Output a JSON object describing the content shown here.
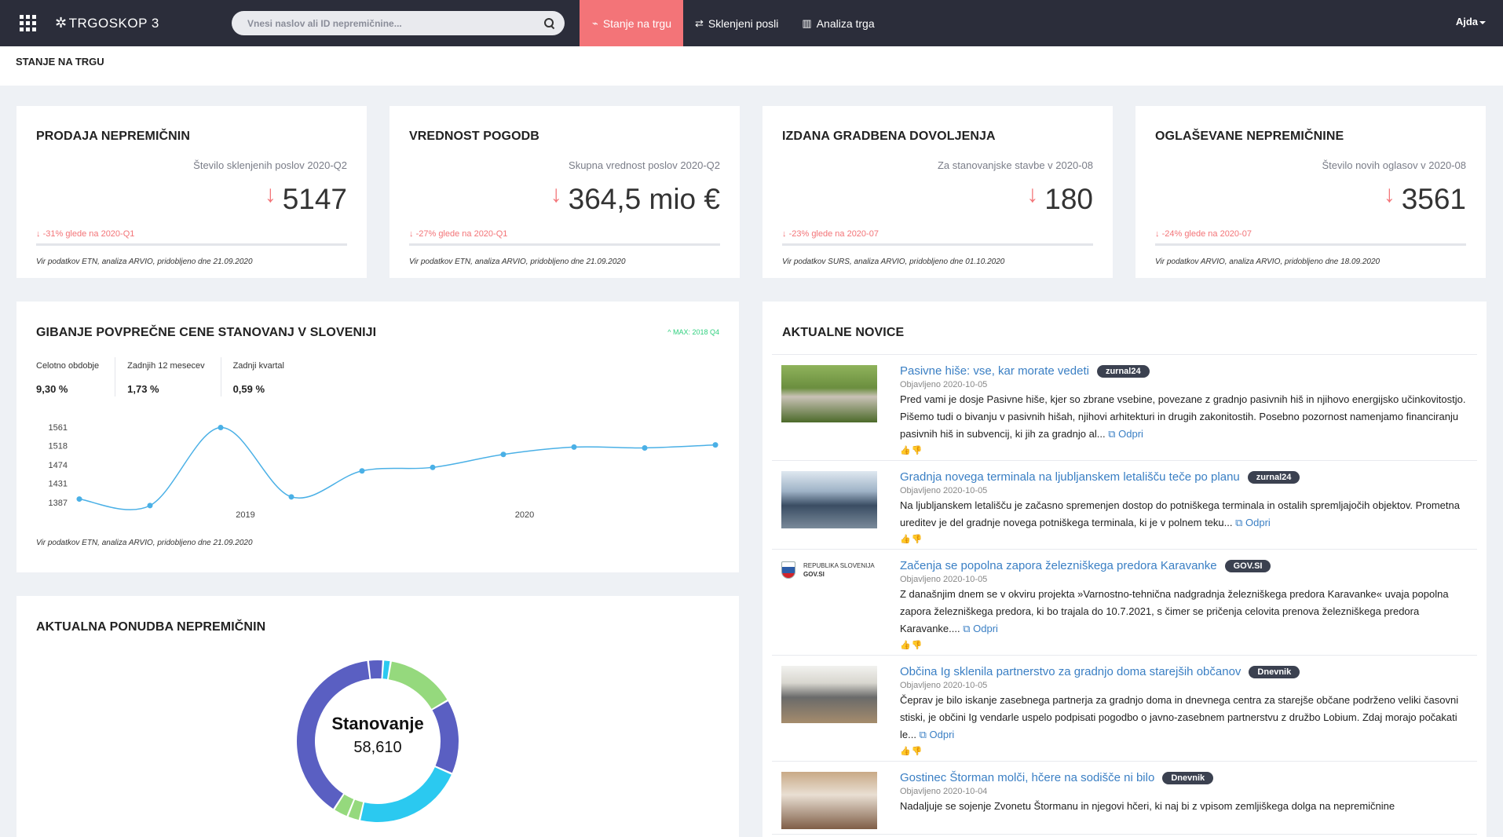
{
  "navbar": {
    "brand": "TRGOSKOP 3",
    "search_placeholder": "Vnesi naslov ali ID nepremičnine...",
    "items": [
      {
        "label": "Stanje na trgu",
        "active": true
      },
      {
        "label": "Sklenjeni posli",
        "active": false
      },
      {
        "label": "Analiza trga",
        "active": false
      }
    ],
    "user": "Ajda"
  },
  "breadcrumb": "STANJE NA TRGU",
  "kpis": [
    {
      "title": "PRODAJA NEPREMIČNIN",
      "subtitle": "Število sklenjenih poslov 2020-Q2",
      "value": "5147",
      "delta": "-31%",
      "delta_text": "glede na 2020-Q1",
      "source": "Vir podatkov ETN, analiza ARVIO, pridobljeno dne 21.09.2020"
    },
    {
      "title": "VREDNOST POGODB",
      "subtitle": "Skupna vrednost poslov 2020-Q2",
      "value": "364,5 mio €",
      "delta": "-27%",
      "delta_text": "glede na 2020-Q1",
      "source": "Vir podatkov ETN, analiza ARVIO, pridobljeno dne 21.09.2020"
    },
    {
      "title": "IZDANA GRADBENA DOVOLJENJA",
      "subtitle": "Za stanovanjske stavbe v 2020-08",
      "value": "180",
      "delta": "-23%",
      "delta_text": "glede na 2020-07",
      "source": "Vir podatkov SURS, analiza ARVIO, pridobljeno dne 01.10.2020"
    },
    {
      "title": "OGLAŠEVANE NEPREMIČNINE",
      "subtitle": "Število novih oglasov v 2020-08",
      "value": "3561",
      "delta": "-24%",
      "delta_text": "glede na 2020-07",
      "source": "Vir podatkov ARVIO, analiza ARVIO, pridobljeno dne 18.09.2020"
    }
  ],
  "price_card": {
    "title": "GIBANJE POVPREČNE CENE STANOVANJ V SLOVENIJI",
    "max_label": "^ MAX: 2018 Q4",
    "stats": [
      {
        "label": "Celotno obdobje",
        "value": "9,30 %"
      },
      {
        "label": "Zadnjih 12 mesecev",
        "value": "1,73 %"
      },
      {
        "label": "Zadnji kvartal",
        "value": "0,59 %"
      }
    ],
    "source": "Vir podatkov ETN, analiza ARVIO, pridobljeno dne 21.09.2020"
  },
  "chart_data": {
    "type": "line",
    "x": [
      "2018-Q2",
      "2018-Q3",
      "2018-Q4",
      "2019-Q1",
      "2019-Q2",
      "2019-Q3",
      "2019-Q4",
      "2020-Q1",
      "2020-Q2",
      "2020-Q3"
    ],
    "values": [
      1395,
      1380,
      1560,
      1400,
      1460,
      1468,
      1498,
      1515,
      1513,
      1520
    ],
    "xticks": [
      "2019",
      "2020"
    ],
    "yticks": [
      "1561",
      "1518",
      "1474",
      "1431",
      "1387"
    ],
    "ylim": [
      1387,
      1561
    ],
    "color": "#4ab0e6",
    "grid": false,
    "title": "",
    "xlabel": "",
    "ylabel": ""
  },
  "offer_card": {
    "title": "AKTUALNA PONUDBA NEPREMIČNIN",
    "center_label": "Stanovanje",
    "center_value": "58,610",
    "segments": [
      {
        "value": 3,
        "color": "#5a5fc2"
      },
      {
        "value": 1.5,
        "color": "#2bc9f0"
      },
      {
        "value": 14,
        "color": "#95d97d"
      },
      {
        "value": 15,
        "color": "#5a5fc2"
      },
      {
        "value": 22,
        "color": "#2bc9f0"
      },
      {
        "value": 2.5,
        "color": "#95d97d"
      },
      {
        "value": 3,
        "color": "#95d97d"
      },
      {
        "value": 39,
        "color": "#5a5fc2"
      }
    ]
  },
  "news_card": {
    "title": "AKTUALNE NOVICE",
    "items": [
      {
        "title": "Pasivne hiše: vse, kar morate vedeti",
        "tag": "zurnal24",
        "date": "Objavljeno 2020-10-05",
        "text": "Pred vami je dosje Pasivne hiše, kjer so zbrane vsebine, povezane z gradnjo pasivnih hiš in njihovo energijsko učinkovitostjo. Pišemo tudi o bivanju v pasivnih hišah, njihovi arhitekturi in drugih zakonitostih. Posebno pozornost namenjamo financiranju pasivnih hiš in subvencij, ki jih za gradnjo al...",
        "open": "Odpri",
        "thumb": "t1"
      },
      {
        "title": "Gradnja novega terminala na ljubljanskem letališču teče po planu",
        "tag": "zurnal24",
        "date": "Objavljeno 2020-10-05",
        "text": "Na ljubljanskem letališču je začasno spremenjen dostop do potniškega terminala in ostalih spremljajočih objektov. Prometna ureditev je del gradnje novega potniškega terminala, ki je v polnem teku...",
        "open": "Odpri",
        "thumb": "t2"
      },
      {
        "title": "Začenja se popolna zapora železniškega predora Karavanke",
        "tag": "GOV.SI",
        "date": "Objavljeno 2020-10-05",
        "text": "Z današnjim dnem se v okviru projekta »Varnostno-tehnična nadgradnja železniškega predora Karavanke« uvaja popolna zapora železniškega predora, ki bo trajala do 10.7.2021, s čimer se pričenja celovita prenova železniškega predora Karavanke....",
        "open": "Odpri",
        "thumb": "t3",
        "gov_line1": "REPUBLIKA SLOVENIJA",
        "gov_line2": "GOV.SI"
      },
      {
        "title": "Občina Ig sklenila partnerstvo za gradnjo doma starejših občanov",
        "tag": "Dnevnik",
        "date": "Objavljeno 2020-10-05",
        "text": "Čeprav je bilo iskanje zasebnega partnerja za gradnjo doma in dnevnega centra za starejše občane podrženo veliki časovni stiski, je občini Ig vendarle uspelo podpisati pogodbo o javno-zasebnem partnerstvu z družbo Lobium. Zdaj morajo počakati le...",
        "open": "Odpri",
        "thumb": "t4"
      },
      {
        "title": "Gostinec Štorman molči, hčere na sodišče ni bilo",
        "tag": "Dnevnik",
        "date": "Objavljeno 2020-10-04",
        "text": "Nadaljuje se sojenje Zvonetu Štormanu in njegovi hčeri, ki naj bi z vpisom zemljiškega dolga na nepremičnine",
        "open": "",
        "thumb": "t5"
      }
    ]
  }
}
